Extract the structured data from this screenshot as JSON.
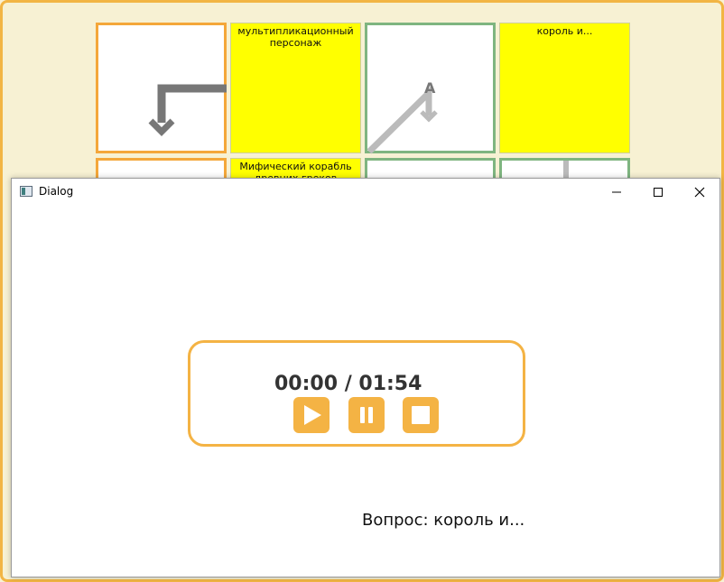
{
  "board": {
    "clues": {
      "cartoon_character": "мультипликационный персонаж",
      "king_and": "король и...",
      "mythic_ship": "Мифический корабль древних греков"
    },
    "arrow_letter": "A"
  },
  "dialog": {
    "title": "Dialog",
    "player": {
      "time": "00:00 / 01:54"
    },
    "question": "Вопрос: король и..."
  },
  "colors": {
    "accent": "#f4b344",
    "clue_yellow": "#ffff00",
    "answer_border_orange": "#f4a73a",
    "answer_border_green": "#7fb580"
  }
}
